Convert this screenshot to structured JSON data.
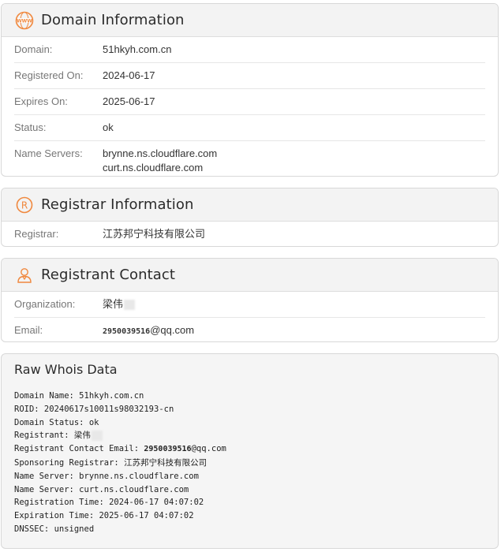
{
  "domain_info": {
    "title": "Domain Information",
    "icon": "www-icon",
    "rows": [
      {
        "label": "Domain:",
        "value": "51hkyh.com.cn"
      },
      {
        "label": "Registered On:",
        "value": "2024-06-17"
      },
      {
        "label": "Expires On:",
        "value": "2025-06-17"
      },
      {
        "label": "Status:",
        "value": "ok"
      }
    ],
    "name_servers": {
      "label": "Name Servers:",
      "values": [
        "brynne.ns.cloudflare.com",
        "curt.ns.cloudflare.com"
      ]
    }
  },
  "registrar_info": {
    "title": "Registrar Information",
    "icon": "registered-icon",
    "rows": [
      {
        "label": "Registrar:",
        "value": "江苏邦宁科技有限公司"
      }
    ]
  },
  "registrant_contact": {
    "title": "Registrant Contact",
    "icon": "person-icon",
    "organization_label": "Organization:",
    "organization_value": "梁伟",
    "email_label": "Email:",
    "email_number": "2950039516",
    "email_domain": "@qq.com"
  },
  "raw_whois": {
    "title": "Raw Whois Data",
    "lines": [
      "Domain Name: 51hkyh.com.cn",
      "ROID: 20240617s10011s98032193-cn",
      "Domain Status: ok",
      "Registrant: 梁伟",
      "Registrant Contact Email: ",
      "Sponsoring Registrar: 江苏邦宁科技有限公司",
      "Name Server: brynne.ns.cloudflare.com",
      "Name Server: curt.ns.cloudflare.com",
      "Registration Time: 2024-06-17 04:07:02",
      "Expiration Time: 2025-06-17 04:07:02",
      "DNSSEC: unsigned"
    ],
    "email_number": "2950039516",
    "email_domain": "@qq.com"
  },
  "colors": {
    "accent_orange": "#f0883e",
    "header_bg": "#f3f3f3",
    "border": "#d8d8d8"
  }
}
